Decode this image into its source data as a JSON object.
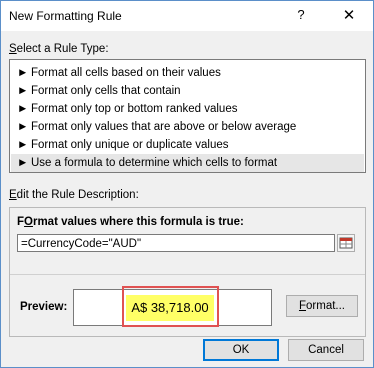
{
  "window": {
    "title": "New Formatting Rule",
    "help_label": "?",
    "close_label": "✕"
  },
  "rule_type": {
    "label_key": "S",
    "label_rest": "elect a Rule Type:",
    "items": [
      {
        "arrow": "►",
        "label": "Format all cells based on their values"
      },
      {
        "arrow": "►",
        "label": "Format only cells that contain"
      },
      {
        "arrow": "►",
        "label": "Format only top or bottom ranked values"
      },
      {
        "arrow": "►",
        "label": "Format only values that are above or below average"
      },
      {
        "arrow": "►",
        "label": "Format only unique or duplicate values"
      },
      {
        "arrow": "►",
        "label": "Use a formula to determine which cells to format"
      }
    ],
    "selected_index": 5
  },
  "description": {
    "label_key": "E",
    "label_rest": "dit the Rule Description:",
    "formula_label_key": "O",
    "formula_label_pre": "F",
    "formula_label_rest": "rmat values where this formula is true:",
    "formula_value": "=CurrencyCode=\"AUD\""
  },
  "preview": {
    "label": "Preview:",
    "sample": "A$ 38,718.00",
    "format_key": "F",
    "format_rest": "ormat..."
  },
  "buttons": {
    "ok": "OK",
    "cancel": "Cancel"
  },
  "colors": {
    "highlight": "#ffff66",
    "callout": "#e05252"
  }
}
